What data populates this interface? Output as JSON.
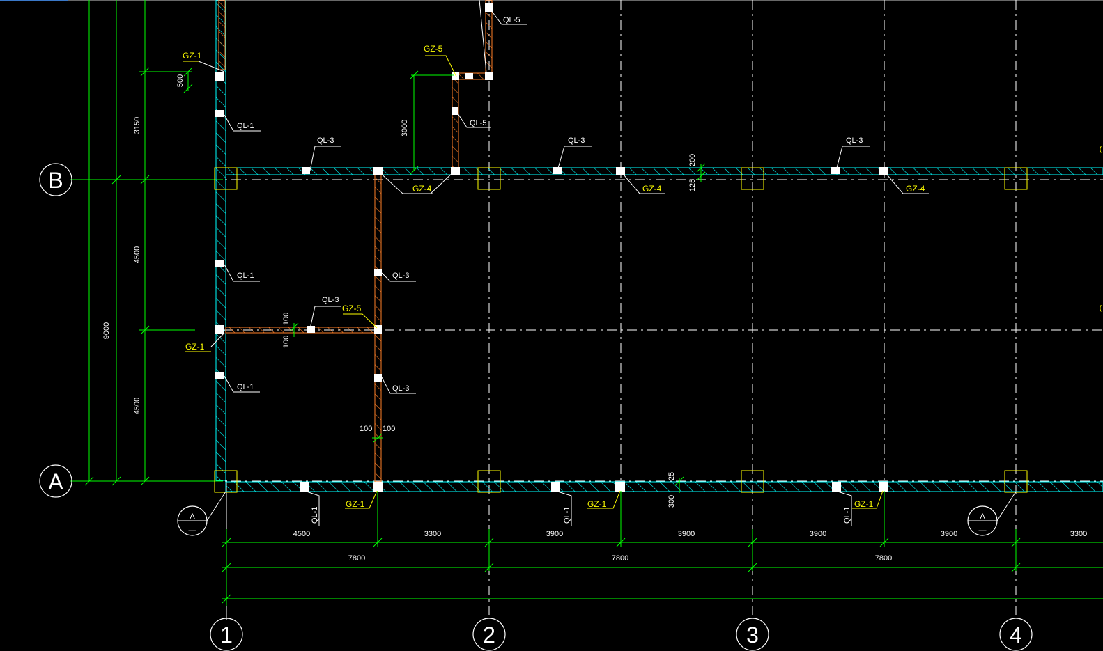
{
  "colors": {
    "background": "#000000",
    "dimension": "#00ff00",
    "wall": "#00ffff",
    "wall_new": "#ff7f27",
    "column": "#ffff00",
    "grid_axis": "#ffffff",
    "label": "#ffffff",
    "yellow_label": "#ffff00"
  },
  "axes": {
    "row_labels": [
      "B",
      "A"
    ],
    "col_labels": [
      "1",
      "2",
      "3",
      "4"
    ],
    "section_marker": {
      "top": "A",
      "bottom": "—"
    }
  },
  "dimensions": {
    "left_vertical": [
      "3150",
      "4500",
      "4500",
      "9000",
      "500"
    ],
    "bottom_row1": [
      "4500",
      "3300",
      "3900",
      "3900",
      "3900",
      "3900",
      "3300"
    ],
    "bottom_row2": [
      "7800",
      "7800",
      "7800"
    ],
    "misc": [
      "3000",
      "200",
      "125",
      "100",
      "100",
      "100",
      "100",
      "25",
      "300"
    ]
  },
  "labels": {
    "gz1": "GZ-1",
    "gz4": "GZ-4",
    "gz5": "GZ-5",
    "ql1": "QL-1",
    "ql3": "QL-3",
    "ql5": "QL-5"
  }
}
